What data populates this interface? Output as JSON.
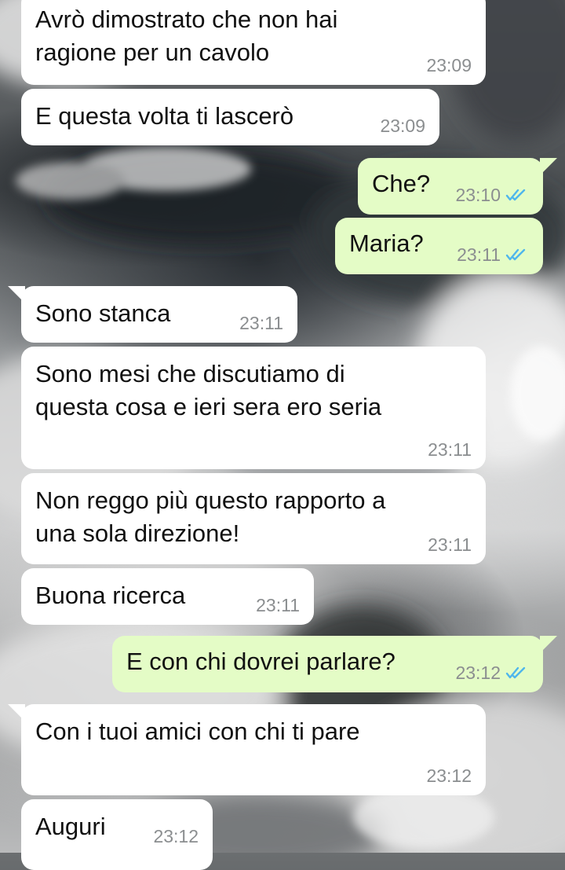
{
  "theme": {
    "incoming_bubble": "#ffffff",
    "outgoing_bubble": "#e4fcc6",
    "timestamp_color": "#8b8e90",
    "read_ticks_color": "#4fb6ec"
  },
  "messages": [
    {
      "direction": "incoming",
      "text": "Avrò dimostrato che non hai\nragione per un cavolo",
      "time": "23:09"
    },
    {
      "direction": "incoming",
      "text": "E questa volta ti lascerò",
      "time": "23:09"
    },
    {
      "direction": "outgoing",
      "text": "Che?",
      "time": "23:10",
      "status": "read-ticks-icon"
    },
    {
      "direction": "outgoing",
      "text": "Maria?",
      "time": "23:11",
      "status": "read-ticks-icon"
    },
    {
      "direction": "incoming",
      "text": "Sono stanca",
      "time": "23:11"
    },
    {
      "direction": "incoming",
      "text": "Sono mesi che discutiamo di\nquesta cosa e ieri sera ero seria",
      "time": "23:11"
    },
    {
      "direction": "incoming",
      "text": "Non reggo più questo rapporto a\nuna sola direzione!",
      "time": "23:11"
    },
    {
      "direction": "incoming",
      "text": "Buona ricerca",
      "time": "23:11"
    },
    {
      "direction": "outgoing",
      "text": "E con chi dovrei parlare?",
      "time": "23:12",
      "status": "read-ticks-icon"
    },
    {
      "direction": "incoming",
      "text": "Con i tuoi amici con chi ti pare",
      "time": "23:12"
    },
    {
      "direction": "incoming",
      "text": "Auguri",
      "time": "23:12"
    }
  ]
}
